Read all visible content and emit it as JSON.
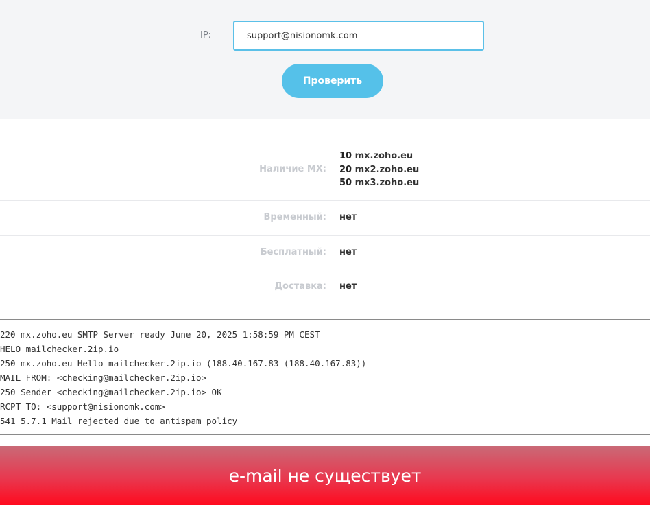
{
  "form": {
    "ip_label": "IP:",
    "email_value": "support@nisionomk.com",
    "check_button_label": "Проверить"
  },
  "results": {
    "mx": {
      "label": "Наличие MX:",
      "records": [
        {
          "priority": "10",
          "host": "mx.zoho.eu"
        },
        {
          "priority": "20",
          "host": "mx2.zoho.eu"
        },
        {
          "priority": "50",
          "host": "mx3.zoho.eu"
        }
      ]
    },
    "temporary": {
      "label": "Временный:",
      "value": "нет"
    },
    "free": {
      "label": "Бесплатный:",
      "value": "нет"
    },
    "delivery": {
      "label": "Доставка:",
      "value": "нет"
    }
  },
  "smtp_log": [
    "220 mx.zoho.eu SMTP Server ready June 20, 2025 1:58:59 PM CEST",
    "HELO mailchecker.2ip.io",
    "250 mx.zoho.eu Hello mailchecker.2ip.io (188.40.167.83 (188.40.167.83))",
    "MAIL FROM: <checking@mailchecker.2ip.io>",
    "250 Sender <checking@mailchecker.2ip.io> OK",
    "RCPT TO: <support@nisionomk.com>",
    "541 5.7.1 Mail rejected due to antispam policy"
  ],
  "status": {
    "text": "e-mail не существует",
    "color": "#ff0a1e"
  }
}
